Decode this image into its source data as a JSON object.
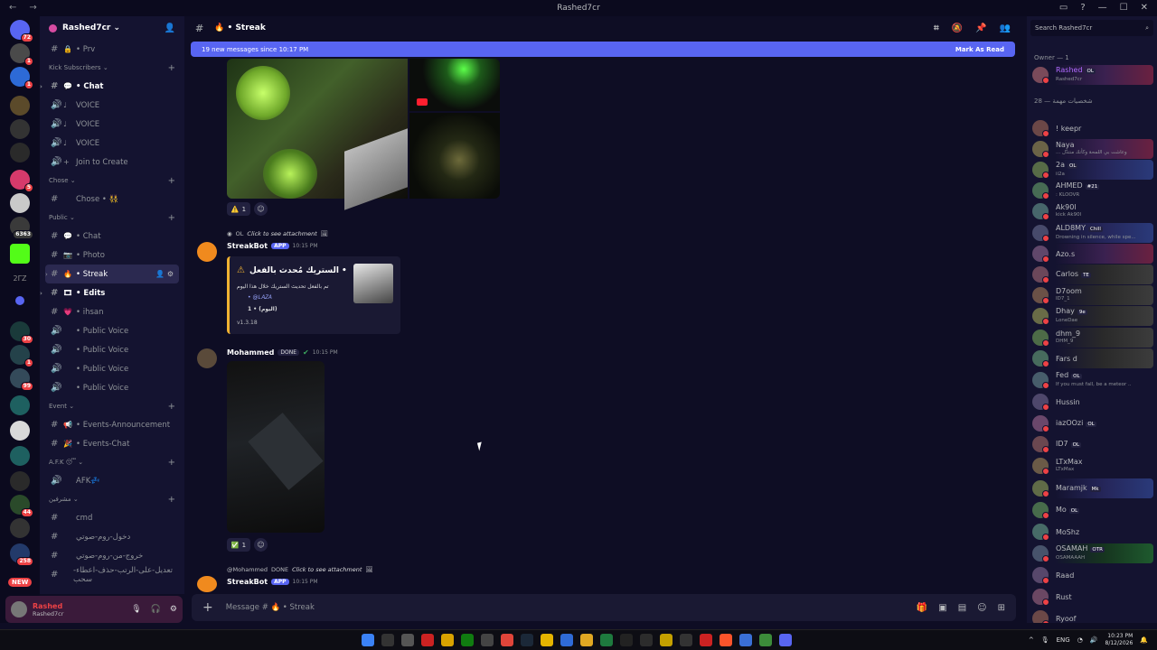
{
  "window": {
    "title": "Rashed7cr"
  },
  "server": {
    "name": "Rashed7cr",
    "badges": [
      "72",
      "1",
      "1",
      "5",
      "6363",
      "30",
      "1",
      "99",
      "44",
      "258"
    ],
    "new_label": "NEW"
  },
  "sidebar": {
    "items": [
      {
        "type": "channel",
        "emoji": "🔒",
        "label": "• Prv"
      },
      {
        "type": "category",
        "label": "Kick Subscribers"
      },
      {
        "type": "channel",
        "emoji": "💬",
        "label": "• Chat",
        "bold": true
      },
      {
        "type": "voice",
        "emoji": "♩",
        "label": "VOICE"
      },
      {
        "type": "voice",
        "emoji": "♩",
        "label": "VOICE"
      },
      {
        "type": "voice",
        "emoji": "♩",
        "label": "VOICE"
      },
      {
        "type": "voice",
        "emoji": "+",
        "label": "Join to Create"
      },
      {
        "type": "category",
        "label": "Chose"
      },
      {
        "type": "channel",
        "emoji": "",
        "label": "Chose • 👯"
      },
      {
        "type": "category",
        "label": "Public"
      },
      {
        "type": "channel",
        "emoji": "💬",
        "label": "• Chat"
      },
      {
        "type": "channel",
        "emoji": "📷",
        "label": "• Photo"
      },
      {
        "type": "channel",
        "emoji": "🔥",
        "label": "• Streak",
        "active": true
      },
      {
        "type": "channel",
        "emoji": "🎞",
        "label": "• Edits",
        "bold": true
      },
      {
        "type": "channel",
        "emoji": "💗",
        "label": "• ihsan"
      },
      {
        "type": "voice",
        "emoji": "",
        "label": "• Public Voice"
      },
      {
        "type": "voice",
        "emoji": "",
        "label": "• Public Voice"
      },
      {
        "type": "voice",
        "emoji": "",
        "label": "• Public Voice"
      },
      {
        "type": "voice",
        "emoji": "",
        "label": "• Public Voice"
      },
      {
        "type": "category",
        "label": "Event"
      },
      {
        "type": "channel",
        "emoji": "📢",
        "label": "• Events-Announcement"
      },
      {
        "type": "channel",
        "emoji": "🎉",
        "label": "• Events-Chat"
      },
      {
        "type": "category",
        "label": "A.F.K 😴"
      },
      {
        "type": "voice",
        "emoji": "",
        "label": "AFK💤"
      },
      {
        "type": "category",
        "label": "مشرفين"
      },
      {
        "type": "channel",
        "emoji": "",
        "label": "cmd"
      },
      {
        "type": "channel",
        "emoji": "",
        "label": "دخول-روم-صوتي"
      },
      {
        "type": "channel",
        "emoji": "",
        "label": "خروج-من-روم-صوتي"
      },
      {
        "type": "channel",
        "emoji": "",
        "label": "تعديل-على-الرتب-حذف-اعطاء-سحب"
      }
    ]
  },
  "user_panel": {
    "name": "Rashed",
    "tag": "Rashed7cr"
  },
  "channel": {
    "name": "🔥 • Streak",
    "new_messages": "19 new messages since 10:17 PM",
    "mark_as_read": "Mark As Read"
  },
  "messages": {
    "react1": {
      "emoji": "⚠️",
      "count": "1"
    },
    "reply1": {
      "text": "Click to see attachment",
      "tag": "OL"
    },
    "bot": {
      "name": "StreakBot",
      "badge": "APP",
      "time": "10:15 PM"
    },
    "embed": {
      "title": "الستريك مُحدث بالفعل •",
      "line1": "تم بالفعل تحديث الستريك خلال هذا اليوم",
      "line2": "• @𝐿𝐴𝑍𝐴",
      "line3": "1 • (اليوم)",
      "version": "v1.3.18"
    },
    "mohammed": {
      "name": "Mohammed",
      "badge": "DONE",
      "time": "10:15 PM"
    },
    "react2": {
      "emoji": "✅",
      "count": "1"
    },
    "reply2": {
      "user": "@Mohammed",
      "tag": "DONE",
      "text": "Click to see attachment"
    },
    "bot2": {
      "name": "StreakBot",
      "badge": "APP",
      "time": "10:15 PM"
    }
  },
  "input": {
    "placeholder": "Message # 🔥 • Streak"
  },
  "members": {
    "search_placeholder": "Search Rashed7cr",
    "owner_heading": "Owner — 1",
    "group_heading": "شخصيات مهمة — 28",
    "owner": {
      "name": "Rashed",
      "tag": "OL",
      "status": "Rashed7cr"
    },
    "list": [
      {
        "name": "! keepr",
        "tag": "",
        "status": "",
        "style": ""
      },
      {
        "name": "Naya",
        "tag": "",
        "status": "... وعاشت بي اللمحة وكأنك منتدّل",
        "style": "hl"
      },
      {
        "name": "2a",
        "tag": "OL",
        "status": "ii2a",
        "style": "hl2"
      },
      {
        "name": "AHMED",
        "tag": "#21",
        "status": ": KLOOVR",
        "style": ""
      },
      {
        "name": "Ak90l",
        "tag": "",
        "status": "kick Ak90l",
        "style": ""
      },
      {
        "name": "ALD8MY",
        "tag": "Chill",
        "status": "Drowning in silence, while spe...",
        "style": "hl2"
      },
      {
        "name": "Azo.s",
        "tag": "",
        "status": "",
        "style": "hl"
      },
      {
        "name": "Carlos",
        "tag": "TE",
        "status": "",
        "style": "hl3"
      },
      {
        "name": "D7oom",
        "tag": "",
        "status": "ID7_1",
        "style": "hl3"
      },
      {
        "name": "Dhay",
        "tag": "9e",
        "status": "LoneDae",
        "style": "hl3"
      },
      {
        "name": "dhm_9",
        "tag": "",
        "status": "DHM_9",
        "style": "hl3"
      },
      {
        "name": "Fars d",
        "tag": "",
        "status": "",
        "style": "hl3"
      },
      {
        "name": "Fed",
        "tag": "OL",
        "status": "If you must fall, be a meteor ..",
        "style": ""
      },
      {
        "name": "Hussin",
        "tag": "",
        "status": "",
        "style": ""
      },
      {
        "name": "iazOOzi",
        "tag": "OL",
        "status": "",
        "style": ""
      },
      {
        "name": "ID7",
        "tag": "OL",
        "status": "",
        "style": ""
      },
      {
        "name": "LTxMax",
        "tag": "",
        "status": "LTxMax",
        "style": ""
      },
      {
        "name": "Maramjk",
        "tag": "Mk",
        "status": "",
        "style": "hl2"
      },
      {
        "name": "Mo",
        "tag": "OL",
        "status": "",
        "style": ""
      },
      {
        "name": "MoShz",
        "tag": "",
        "status": "",
        "style": ""
      },
      {
        "name": "OSAMAH",
        "tag": "OTR",
        "status": "OSAMAAAH",
        "style": "hl4"
      },
      {
        "name": "Raad",
        "tag": "",
        "status": "",
        "style": ""
      },
      {
        "name": "Rust",
        "tag": "",
        "status": "",
        "style": ""
      },
      {
        "name": "Ryoof",
        "tag": "",
        "status": "",
        "style": ""
      }
    ]
  },
  "taskbar": {
    "lang": "ENG",
    "time": "10:23 PM",
    "date": "8/12/2026"
  }
}
